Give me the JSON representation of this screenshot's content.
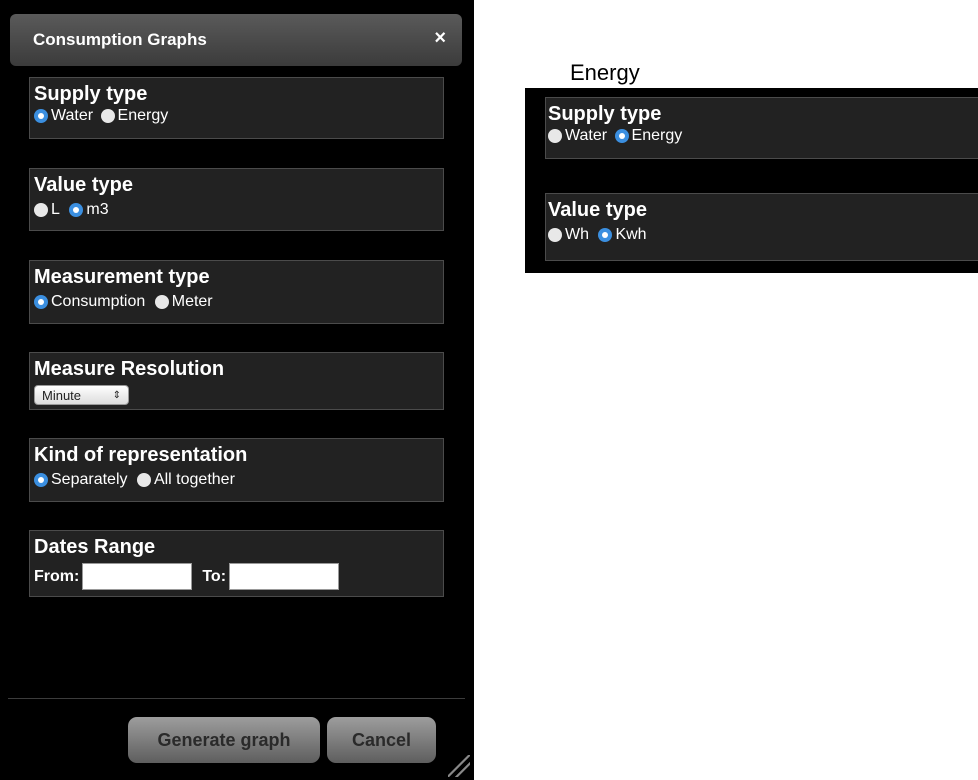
{
  "dialog": {
    "title": "Consumption Graphs",
    "close_glyph": "×",
    "supply": {
      "heading": "Supply type",
      "options": [
        "Water",
        "Energy"
      ],
      "selected": "Water"
    },
    "value": {
      "heading": "Value type",
      "options": [
        "L",
        "m3"
      ],
      "selected": "m3"
    },
    "measurement": {
      "heading": "Measurement type",
      "options": [
        "Consumption",
        "Meter"
      ],
      "selected": "Consumption"
    },
    "resolution": {
      "heading": "Measure Resolution",
      "selected": "Minute",
      "arrows": "⇕"
    },
    "representation": {
      "heading": "Kind of representation",
      "options": [
        "Separately",
        "All together"
      ],
      "selected": "Separately"
    },
    "dates": {
      "heading": "Dates Range",
      "from_label": "From:",
      "to_label": "To:",
      "from_value": "",
      "to_value": ""
    },
    "buttons": {
      "generate": "Generate graph",
      "cancel": "Cancel"
    }
  },
  "energy_view": {
    "label": "Energy",
    "supply": {
      "heading": "Supply type",
      "options": [
        "Water",
        "Energy"
      ],
      "selected": "Energy"
    },
    "value": {
      "heading": "Value type",
      "options": [
        "Wh",
        "Kwh"
      ],
      "selected": "Kwh"
    }
  },
  "colors": {
    "radio_selected": "#3b8fe0",
    "radio_unselected": "#e8e8e8",
    "panel_bg": "#000000",
    "box_bg": "#222222"
  }
}
